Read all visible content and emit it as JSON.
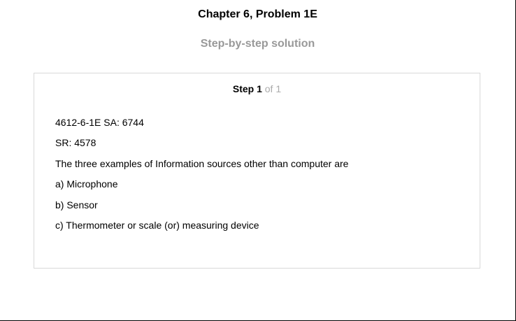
{
  "header": {
    "chapter_title": "Chapter 6, Problem 1E",
    "solution_title": "Step-by-step solution"
  },
  "step": {
    "label": "Step 1",
    "of_text": " of 1",
    "lines": [
      "4612-6-1E SA: 6744",
      "SR: 4578",
      "The three examples of Information sources other than computer are",
      "a) Microphone",
      "b) Sensor",
      "c) Thermometer or scale (or) measuring device"
    ]
  },
  "colors": {
    "text": "#000000",
    "muted": "#999999",
    "box_border": "#d9d9d9"
  }
}
